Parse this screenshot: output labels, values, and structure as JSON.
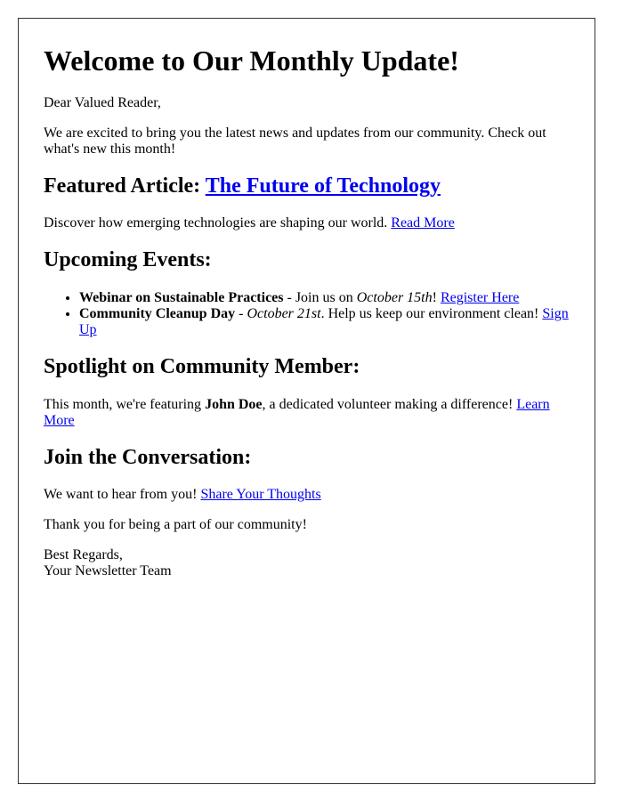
{
  "header": {
    "title": "Welcome to Our Monthly Update!"
  },
  "greeting": "Dear Valued Reader,",
  "intro": "We are excited to bring you the latest news and updates from our community. Check out what's new this month!",
  "featured": {
    "heading_prefix": "Featured Article: ",
    "article_link": "The Future of Technology",
    "description": "Discover how emerging technologies are shaping our world. ",
    "read_more_link": "Read More"
  },
  "events": {
    "heading": "Upcoming Events:",
    "items": [
      {
        "name": "Webinar on Sustainable Practices",
        "sep": " - Join us on ",
        "date": "October 15th",
        "after": "! ",
        "link": "Register Here"
      },
      {
        "name": "Community Cleanup Day",
        "sep": " - ",
        "date": "October 21st",
        "after": ". Help us keep our environment clean! ",
        "link": "Sign Up"
      }
    ]
  },
  "spotlight": {
    "heading": "Spotlight on Community Member:",
    "before": "This month, we're featuring ",
    "member": "John Doe",
    "after": ", a dedicated volunteer making a difference! ",
    "link": "Learn More"
  },
  "conversation": {
    "heading": "Join the Conversation:",
    "text": "We want to hear from you! ",
    "link": "Share Your Thoughts"
  },
  "thanks": "Thank you for being a part of our community!",
  "signoff": {
    "line1": "Best Regards,",
    "line2": "Your Newsletter Team"
  }
}
